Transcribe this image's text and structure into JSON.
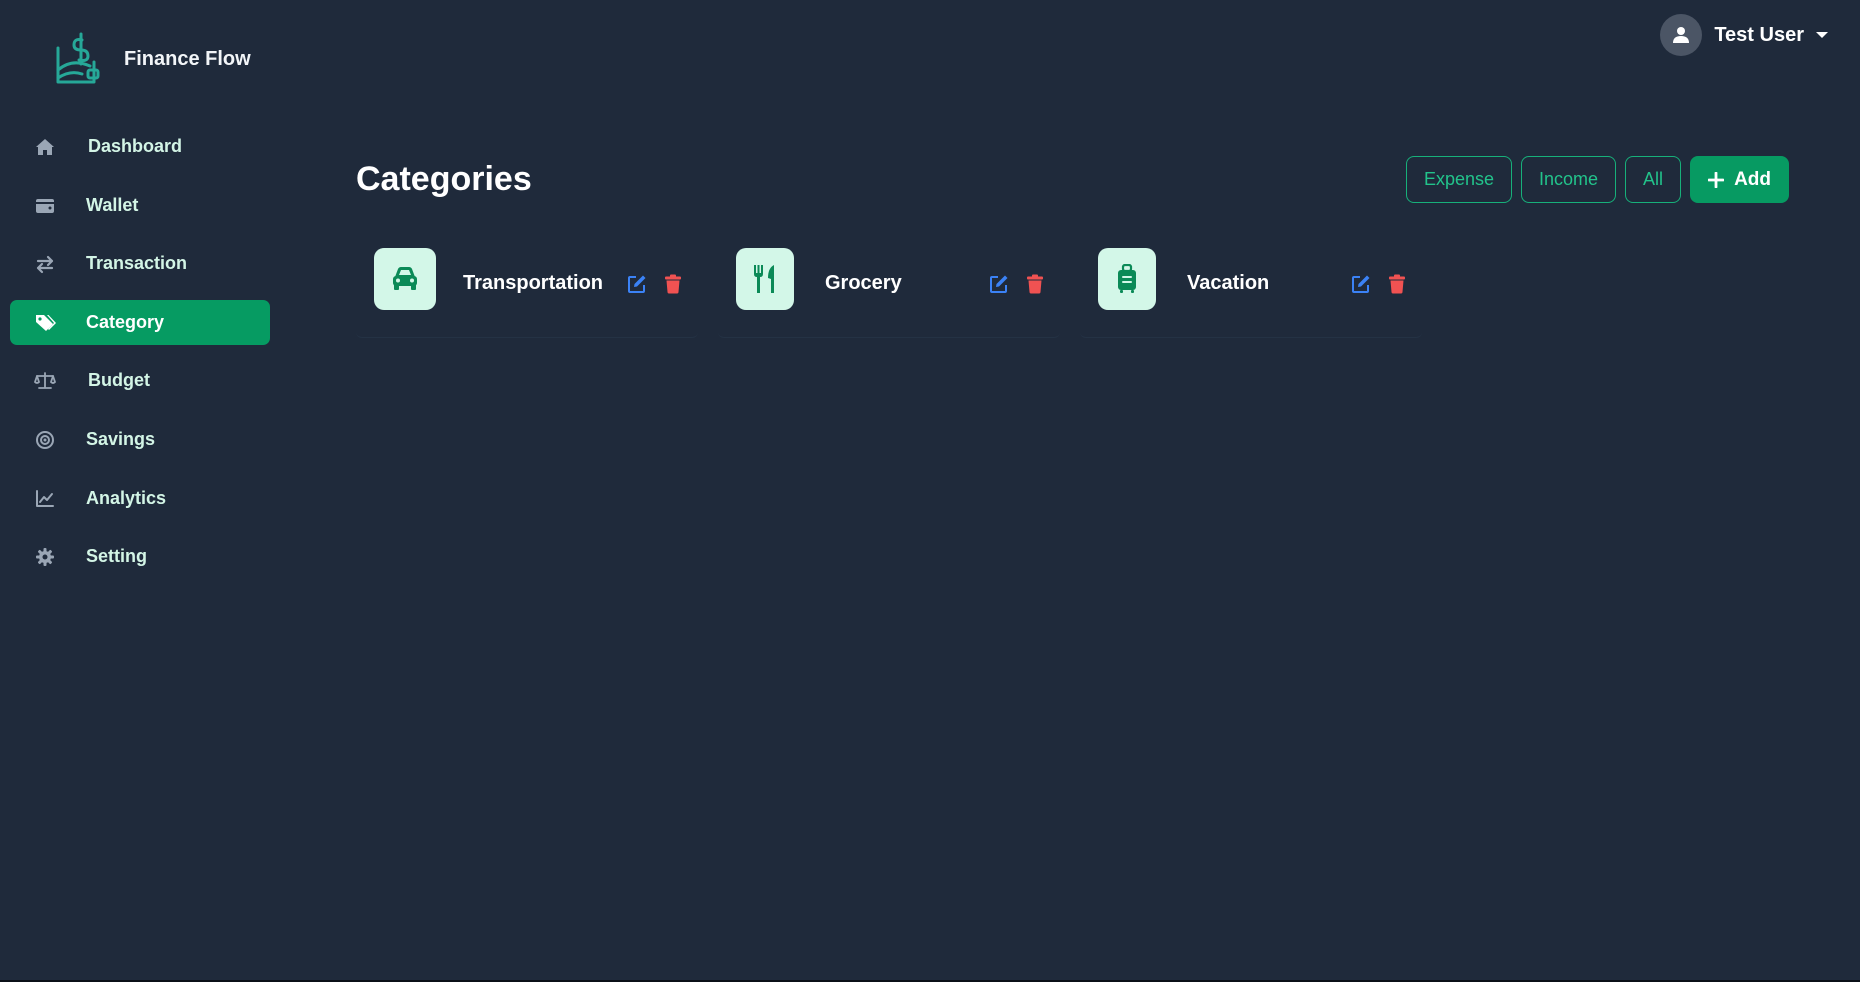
{
  "brand": {
    "name": "Finance Flow"
  },
  "sidebar": {
    "items": [
      {
        "label": "Dashboard",
        "icon": "home-icon",
        "active": false
      },
      {
        "label": "Wallet",
        "icon": "wallet-icon",
        "active": false
      },
      {
        "label": "Transaction",
        "icon": "arrows-exchange-icon",
        "active": false
      },
      {
        "label": "Category",
        "icon": "tags-icon",
        "active": true
      },
      {
        "label": "Budget",
        "icon": "scale-icon",
        "active": false
      },
      {
        "label": "Savings",
        "icon": "target-icon",
        "active": false
      },
      {
        "label": "Analytics",
        "icon": "line-chart-icon",
        "active": false
      },
      {
        "label": "Setting",
        "icon": "gear-icon",
        "active": false
      }
    ]
  },
  "user": {
    "name": "Test User",
    "icon": "user-icon"
  },
  "main": {
    "title": "Categories",
    "filters": {
      "expense": "Expense",
      "income": "Income",
      "all": "All"
    },
    "add_label": "Add",
    "categories": [
      {
        "label": "Transportation",
        "icon": "car-icon"
      },
      {
        "label": "Grocery",
        "icon": "utensils-icon"
      },
      {
        "label": "Vacation",
        "icon": "suitcase-icon"
      }
    ]
  },
  "colors": {
    "background": "#1f2a3b",
    "accent": "#069b62",
    "accent_text": "#22c38b",
    "icon_bg": "#d3f7e8",
    "edit": "#3b82f6",
    "delete": "#f05252"
  }
}
